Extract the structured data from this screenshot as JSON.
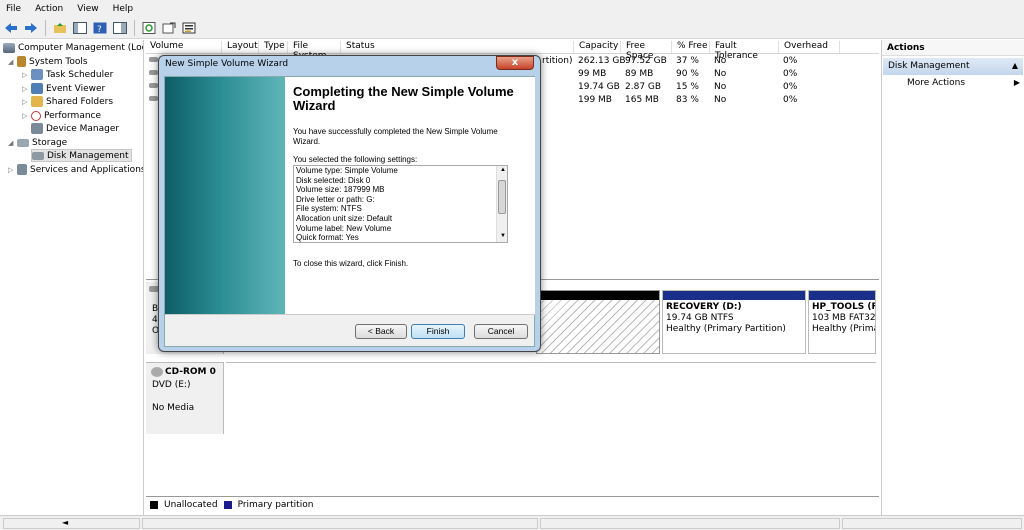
{
  "menu": [
    "File",
    "Action",
    "View",
    "Help"
  ],
  "tree": {
    "root": "Computer Management (Local",
    "system_tools": "System Tools",
    "task_scheduler": "Task Scheduler",
    "event_viewer": "Event Viewer",
    "shared_folders": "Shared Folders",
    "performance": "Performance",
    "device_manager": "Device Manager",
    "storage": "Storage",
    "disk_management": "Disk Management",
    "services": "Services and Applications"
  },
  "volume_table": {
    "headers": [
      "Volume",
      "Layout",
      "Type",
      "File System",
      "Status",
      "Capacity",
      "Free Space",
      "% Free",
      "Fault Tolerance",
      "Overhead"
    ],
    "status_partial": "rtition)",
    "rows": [
      {
        "capacity": "262.13 GB",
        "free": "97.52 GB",
        "pct": "37 %",
        "fault": "No",
        "overhead": "0%"
      },
      {
        "capacity": "99 MB",
        "free": "89 MB",
        "pct": "90 %",
        "fault": "No",
        "overhead": "0%"
      },
      {
        "capacity": "19.74 GB",
        "free": "2.87 GB",
        "pct": "15 %",
        "fault": "No",
        "overhead": "0%"
      },
      {
        "capacity": "199 MB",
        "free": "165 MB",
        "pct": "83 %",
        "fault": "No",
        "overhead": "0%"
      }
    ]
  },
  "graphical": {
    "disk0_partial": [
      "B",
      "4(",
      "O"
    ],
    "recovery_name": "RECOVERY  (D:)",
    "recovery_size": "19.74 GB NTFS",
    "recovery_status": "Healthy (Primary Partition)",
    "hptools_name": "HP_TOOLS  (F:",
    "hptools_size": "103 MB FAT32",
    "hptools_status": "Healthy (Prima",
    "cdrom_name": "CD-ROM 0",
    "cdrom_type": "DVD (E:)",
    "cdrom_media": "No Media"
  },
  "legend": {
    "unallocated": "Unallocated",
    "primary": "Primary partition",
    "unallocated_color": "#000000",
    "primary_color": "#1a1a8c"
  },
  "actions": {
    "header": "Actions",
    "section": "Disk Management",
    "more": "More Actions"
  },
  "dialog": {
    "title": "New Simple Volume Wizard",
    "close": "x",
    "heading": "Completing the New Simple Volume Wizard",
    "success": "You have successfully completed the New Simple Volume Wizard.",
    "selected_label": "You selected the following settings:",
    "settings": [
      "Volume type: Simple Volume",
      "Disk selected: Disk 0",
      "Volume size: 187999 MB",
      "Drive letter or path: G:",
      "File system: NTFS",
      "Allocation unit size: Default",
      "Volume label: New Volume",
      "Quick format: Yes"
    ],
    "close_instructions": "To close this wizard, click Finish.",
    "back": "< Back",
    "finish": "Finish",
    "cancel": "Cancel"
  }
}
